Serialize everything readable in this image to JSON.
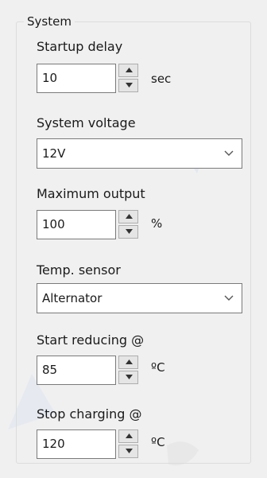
{
  "group": {
    "title": "System"
  },
  "startup_delay": {
    "label": "Startup delay",
    "value": "10",
    "unit": "sec"
  },
  "system_voltage": {
    "label": "System voltage",
    "selected": "12V"
  },
  "maximum_output": {
    "label": "Maximum output",
    "value": "100",
    "unit": "%"
  },
  "temp_sensor": {
    "label": "Temp. sensor",
    "selected": "Alternator"
  },
  "start_reducing": {
    "label": "Start reducing @",
    "value": "85",
    "unit": "ºC"
  },
  "stop_charging": {
    "label": "Stop charging @",
    "value": "120",
    "unit": "ºC"
  },
  "icons": {
    "spin_up": "caret-up-icon",
    "spin_down": "caret-down-icon",
    "dropdown": "chevron-down-icon"
  }
}
